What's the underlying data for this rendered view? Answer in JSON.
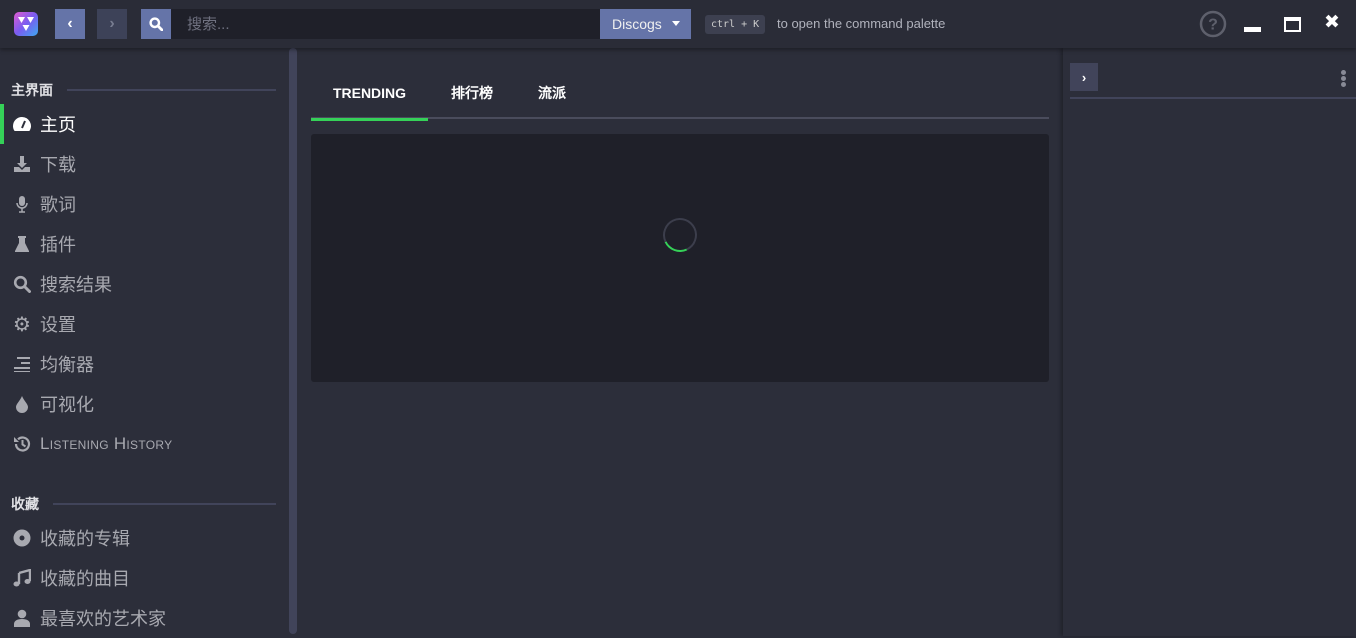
{
  "header": {
    "search_placeholder": "搜索...",
    "search_provider": "Discogs",
    "shortcut": "ctrl + K",
    "shortcut_hint": "to open the command palette"
  },
  "sidebar": {
    "sections": [
      {
        "title": "主界面",
        "items": [
          {
            "label": "主页",
            "icon": "dashboard-icon",
            "active": true
          },
          {
            "label": "下载",
            "icon": "download-icon"
          },
          {
            "label": "歌词",
            "icon": "microphone-icon"
          },
          {
            "label": "插件",
            "icon": "flask-icon"
          },
          {
            "label": "搜索结果",
            "icon": "search-icon"
          },
          {
            "label": "设置",
            "icon": "gear-icon"
          },
          {
            "label": "均衡器",
            "icon": "equalizer-icon"
          },
          {
            "label": "可视化",
            "icon": "drop-icon"
          },
          {
            "label": "Listening History",
            "icon": "history-icon"
          }
        ]
      },
      {
        "title": "收藏",
        "items": [
          {
            "label": "收藏的专辑",
            "icon": "disc-icon"
          },
          {
            "label": "收藏的曲目",
            "icon": "music-icon"
          },
          {
            "label": "最喜欢的艺术家",
            "icon": "user-icon"
          }
        ]
      }
    ]
  },
  "main": {
    "tabs": [
      {
        "label": "TRENDING",
        "active": true
      },
      {
        "label": "排行榜"
      },
      {
        "label": "流派"
      }
    ]
  },
  "colors": {
    "accent": "#35d158",
    "button": "#6574a8",
    "background": "#2c2e3a",
    "panel": "#1f2029"
  }
}
